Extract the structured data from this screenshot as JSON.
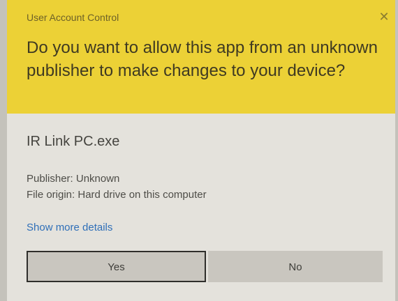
{
  "dialog": {
    "window_title": "User Account Control",
    "close_glyph": "✕",
    "question": "Do you want to allow this app from an unknown publisher to make changes to your device?",
    "app_name": "IR Link PC.exe",
    "publisher": "Publisher: Unknown",
    "file_origin": "File origin: Hard drive on this computer",
    "more_details_label": "Show more details",
    "yes_label": "Yes",
    "no_label": "No"
  },
  "colors": {
    "header_background": "#ecd136",
    "body_background": "#e4e2dc",
    "link": "#2f6fb8",
    "button_background": "#c9c6bf"
  },
  "icons": {
    "close": "close-icon"
  }
}
